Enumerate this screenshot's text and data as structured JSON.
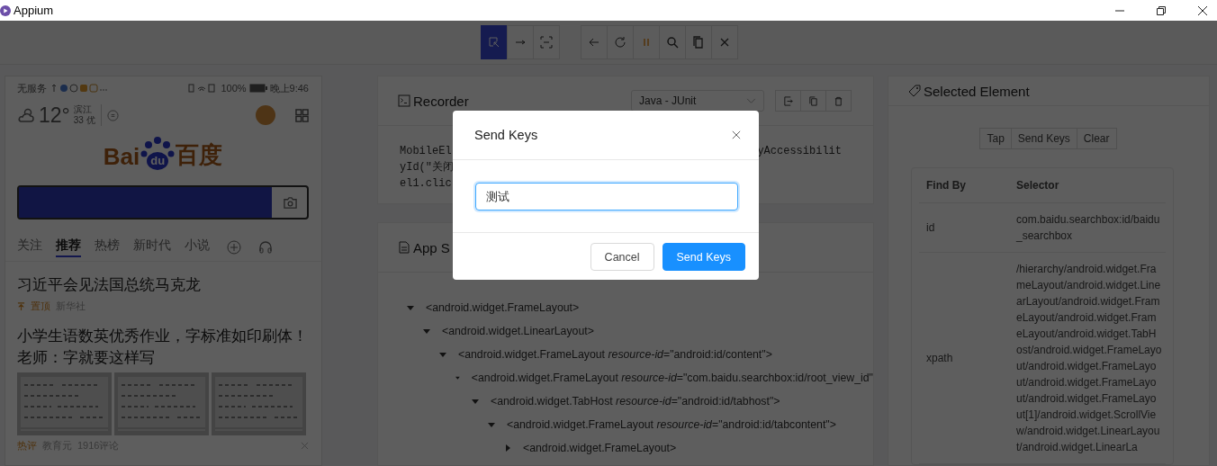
{
  "window": {
    "title": "Appium"
  },
  "toolbar": {
    "modes": [
      {
        "selected": true
      },
      {
        "selected": false
      },
      {
        "selected": false
      }
    ]
  },
  "device": {
    "status_bar": {
      "carrier": "无服务",
      "battery": "100%",
      "time": "晚上9:46"
    },
    "weather": {
      "temp": "12°",
      "city": "滨江",
      "aqi": "33 优"
    },
    "logo": {
      "left": "Bai",
      "mid": "du",
      "right": "百度"
    },
    "search_box": {
      "highlighted": true
    },
    "tabs": [
      {
        "label": "关注",
        "selected": false
      },
      {
        "label": "推荐",
        "selected": true
      },
      {
        "label": "热榜",
        "selected": false
      },
      {
        "label": "新时代",
        "selected": false
      },
      {
        "label": "小说",
        "selected": false
      }
    ],
    "news": [
      {
        "title": "习近平会见法国总统马克龙",
        "tag": "置顶",
        "source": "新华社"
      },
      {
        "title": "小学生语数英优秀作业，字标准如印刷体！老师：字就要这样写",
        "tag": "热评",
        "source": "教育元",
        "comments": "1916评论"
      }
    ]
  },
  "recorder": {
    "title": "Recorder",
    "language": "Java - JUnit",
    "code": [
      {
        "left": "MobileEl",
        "right": "yAccessibilit"
      },
      {
        "left": "yId(\"关闭"
      },
      {
        "left": "el1.clic"
      }
    ]
  },
  "app_source": {
    "title": "App S",
    "tree": [
      {
        "text": "<android.widget.FrameLayout>",
        "expanded": true,
        "children": [
          {
            "text": "<android.widget.LinearLayout>",
            "expanded": true,
            "children": [
              {
                "text": "<android.widget.FrameLayout *resource-id*=\"android:id/content\">",
                "expanded": true,
                "children": [
                  {
                    "text": "<android.widget.FrameLayout *resource-id*=\"com.baidu.searchbox:id/root_view_id\"",
                    "expanded": true,
                    "children": [
                      {
                        "text": "<android.widget.TabHost *resource-id*=\"android:id/tabhost\">",
                        "expanded": true,
                        "children": [
                          {
                            "text": "<android.widget.FrameLayout *resource-id*=\"android:id/tabcontent\">",
                            "expanded": true,
                            "children": [
                              {
                                "text": "<android.widget.FrameLayout>",
                                "expanded": false
                              }
                            ]
                          }
                        ]
                      }
                    ]
                  }
                ]
              }
            ]
          }
        ]
      }
    ]
  },
  "selected_element": {
    "title": "Selected Element",
    "actions": [
      "Tap",
      "Send Keys",
      "Clear"
    ],
    "columns": [
      "Find By",
      "Selector"
    ],
    "rows": [
      {
        "find_by": "id",
        "selector": "com.baidu.searchbox:id/baidu_searchbox"
      },
      {
        "find_by": "xpath",
        "selector": "/hierarchy/android.widget.FrameLayout/android.widget.LinearLayout/android.widget.FrameLayout/android.widget.FrameLayout/android.widget.TabHost/android.widget.FrameLayout/android.widget.FrameLayout/android.widget.FrameLayout/android.widget.FrameLayout[1]/android.widget.ScrollView/android.widget.LinearLayout/android.widget.LinearLa"
      }
    ]
  },
  "dialog": {
    "title": "Send Keys",
    "value": "测试",
    "buttons": [
      {
        "label": "Cancel",
        "kind": "default"
      },
      {
        "label": "Send Keys",
        "kind": "primary"
      }
    ]
  }
}
